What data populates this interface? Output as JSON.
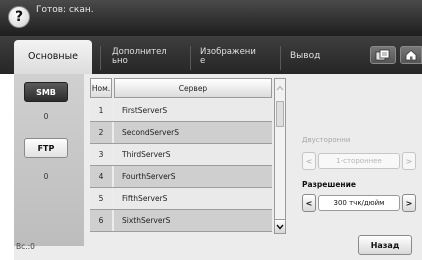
{
  "status": {
    "text": "Готов: скан."
  },
  "help": {
    "label": "?"
  },
  "tabs": [
    {
      "label": "Основные",
      "active": true
    },
    {
      "line1": "Дополнител",
      "line2": "ьно"
    },
    {
      "line1": "Изображени",
      "line2": "е"
    },
    {
      "label": "Вывод"
    }
  ],
  "icons": {
    "job_icon": "document-icon",
    "home_icon": "home-icon"
  },
  "sidebar": {
    "items": [
      {
        "label": "SMB",
        "count": "0",
        "selected": true
      },
      {
        "label": "FTP",
        "count": "0",
        "selected": false
      }
    ]
  },
  "table": {
    "headers": {
      "num": "Ном.",
      "server": "Сервер"
    },
    "rows": [
      {
        "num": "1",
        "server": "FirstServerS"
      },
      {
        "num": "2",
        "server": "SecondServerS"
      },
      {
        "num": "3",
        "server": "ThirdServerS"
      },
      {
        "num": "4",
        "server": "FourthServerS"
      },
      {
        "num": "5",
        "server": "FifthServerS"
      },
      {
        "num": "6",
        "server": "SixthServerS"
      }
    ]
  },
  "settings": {
    "duplex": {
      "label": "Двусторонни",
      "value": "1-стороннее",
      "enabled": false
    },
    "resolution": {
      "label": "Разрешение",
      "value": "300 тчк/дюйм",
      "enabled": true
    }
  },
  "footer": {
    "count": "Вс.:0",
    "back_label": "Назад"
  },
  "colors": {
    "topbar": "#1e1e1e",
    "tab_active": "#e8e8e8",
    "row_dark": "#cfcfcf",
    "row_light": "#eaeaea"
  }
}
